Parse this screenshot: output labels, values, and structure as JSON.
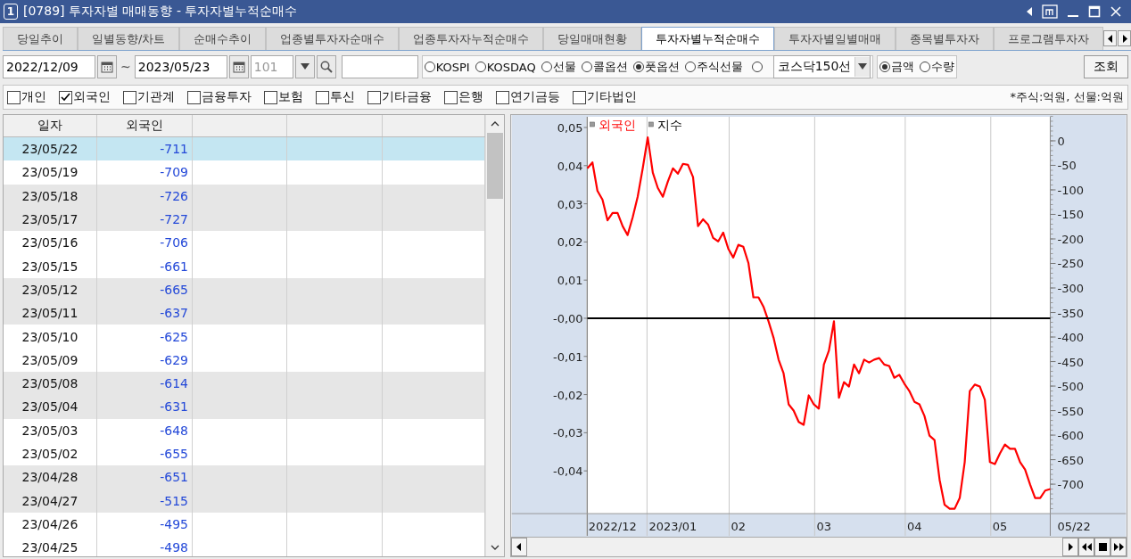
{
  "window": {
    "badge": "1",
    "title": "[0789] 투자자별 매매동향 - 투자자별누적순매수"
  },
  "tabs": [
    {
      "label": "당일추이",
      "selected": false
    },
    {
      "label": "일별동향/차트",
      "selected": false
    },
    {
      "label": "순매수추이",
      "selected": false
    },
    {
      "label": "업종별투자자순매수",
      "selected": false
    },
    {
      "label": "업종투자자누적순매수",
      "selected": false
    },
    {
      "label": "당일매매현황",
      "selected": false
    },
    {
      "label": "투자자별누적순매수",
      "selected": true
    },
    {
      "label": "투자자별일별매매",
      "selected": false
    },
    {
      "label": "종목별투자자",
      "selected": false
    },
    {
      "label": "프로그램투자자",
      "selected": false
    }
  ],
  "query": {
    "start_date": "2022/12/09",
    "separator": "~",
    "end_date": "2023/05/23",
    "code": {
      "value": "101",
      "disabled": true
    },
    "market_options": [
      {
        "label": "KOSPI",
        "selected": false
      },
      {
        "label": "KOSDAQ",
        "selected": false
      },
      {
        "label": "선물",
        "selected": false
      },
      {
        "label": "콜옵션",
        "selected": false
      },
      {
        "label": "풋옵션",
        "selected": true
      },
      {
        "label": "주식선물",
        "selected": false
      }
    ],
    "index_option": {
      "selected": false,
      "combo": "코스닥150선"
    },
    "unit_options": [
      {
        "label": "금액",
        "selected": true
      },
      {
        "label": "수량",
        "selected": false
      }
    ],
    "submit": "조회"
  },
  "investors": [
    {
      "label": "개인",
      "checked": false
    },
    {
      "label": "외국인",
      "checked": true
    },
    {
      "label": "기관계",
      "checked": false
    },
    {
      "label": "금융투자",
      "checked": false
    },
    {
      "label": "보험",
      "checked": false
    },
    {
      "label": "투신",
      "checked": false
    },
    {
      "label": "기타금융",
      "checked": false
    },
    {
      "label": "은행",
      "checked": false
    },
    {
      "label": "연기금등",
      "checked": false
    },
    {
      "label": "기타법인",
      "checked": false
    }
  ],
  "unit_note": "*주식:억원, 선물:억원",
  "table": {
    "columns": [
      "일자",
      "외국인"
    ],
    "rows": [
      {
        "date": "23/05/22",
        "value": "-711",
        "selected": true
      },
      {
        "date": "23/05/19",
        "value": "-709",
        "selected": false
      },
      {
        "date": "23/05/18",
        "value": "-726",
        "selected": false
      },
      {
        "date": "23/05/17",
        "value": "-727",
        "selected": false
      },
      {
        "date": "23/05/16",
        "value": "-706",
        "selected": false
      },
      {
        "date": "23/05/15",
        "value": "-661",
        "selected": false
      },
      {
        "date": "23/05/12",
        "value": "-665",
        "selected": false
      },
      {
        "date": "23/05/11",
        "value": "-637",
        "selected": false
      },
      {
        "date": "23/05/10",
        "value": "-625",
        "selected": false
      },
      {
        "date": "23/05/09",
        "value": "-629",
        "selected": false
      },
      {
        "date": "23/05/08",
        "value": "-614",
        "selected": false
      },
      {
        "date": "23/05/04",
        "value": "-631",
        "selected": false
      },
      {
        "date": "23/05/03",
        "value": "-648",
        "selected": false
      },
      {
        "date": "23/05/02",
        "value": "-655",
        "selected": false
      },
      {
        "date": "23/04/28",
        "value": "-651",
        "selected": false
      },
      {
        "date": "23/04/27",
        "value": "-515",
        "selected": false
      },
      {
        "date": "23/04/26",
        "value": "-495",
        "selected": false
      },
      {
        "date": "23/04/25",
        "value": "-498",
        "selected": false
      }
    ]
  },
  "chart": {
    "chart_data": {
      "type": "line",
      "categories": [
        null,
        null,
        null,
        null,
        null,
        "2022/12",
        null,
        null,
        null,
        null,
        null,
        null,
        null,
        null,
        null,
        null,
        null,
        "2023/01",
        null,
        null,
        null,
        null,
        null,
        null,
        null,
        null,
        null,
        null,
        null,
        null,
        "02",
        null,
        null,
        null,
        null,
        null,
        null,
        null,
        null,
        null,
        null,
        null,
        null,
        null,
        null,
        null,
        null,
        "03",
        null,
        null,
        null,
        null,
        null,
        null,
        null,
        null,
        null,
        null,
        null,
        null,
        null,
        null,
        null,
        null,
        null,
        "04",
        null,
        null,
        null,
        null,
        null,
        null,
        null,
        null,
        null,
        null,
        null,
        null,
        null,
        null,
        null,
        null,
        "05",
        null,
        null,
        null,
        null,
        null,
        null,
        null,
        null,
        null,
        null
      ],
      "series": [
        {
          "name": "외국인",
          "color": "#ff0000",
          "axis": "y2",
          "values": [
            -56,
            -44,
            -102,
            -120,
            -162,
            -147,
            -147,
            -174,
            -192,
            -156,
            -114,
            -56,
            7,
            -65,
            -96,
            -114,
            -83,
            -56,
            -67,
            -47,
            -49,
            -74,
            -174,
            -160,
            -171,
            -198,
            -205,
            -187,
            -220,
            -238,
            -212,
            -216,
            -249,
            -319,
            -319,
            -338,
            -368,
            -401,
            -446,
            -474,
            -537,
            -550,
            -573,
            -579,
            -519,
            -537,
            -546,
            -456,
            -428,
            -368,
            -524,
            -492,
            -501,
            -456,
            -474,
            -446,
            -452,
            -446,
            -443,
            -456,
            -459,
            -483,
            -477,
            -495,
            -510,
            -532,
            -537,
            -561,
            -601,
            -610,
            -691,
            -742,
            -750,
            -750,
            -728,
            -655,
            -510,
            -497,
            -501,
            -528,
            -655,
            -659,
            -637,
            -619,
            -628,
            -628,
            -655,
            -670,
            -701,
            -728,
            -728,
            -713,
            -710
          ]
        },
        {
          "name": "지수",
          "color": "#000000",
          "values": [
            0,
            0,
            0,
            0,
            0,
            0,
            0,
            0,
            0,
            0,
            0,
            0,
            0,
            0,
            0,
            0,
            0,
            0,
            0,
            0,
            0,
            0,
            0,
            0,
            0,
            0,
            0,
            0,
            0,
            0,
            0,
            0,
            0,
            0,
            0,
            0,
            0,
            0,
            0,
            0,
            0,
            0,
            0,
            0,
            0,
            0,
            0,
            0,
            0,
            0,
            0,
            0,
            0,
            0,
            0,
            0,
            0,
            0,
            0,
            0,
            0,
            0,
            0,
            0,
            0,
            0,
            0,
            0,
            0,
            0,
            0,
            0,
            0,
            0,
            0,
            0,
            0,
            0,
            0,
            0,
            0,
            0,
            0,
            0,
            0,
            0,
            0,
            0,
            0,
            0,
            0,
            0,
            0
          ]
        }
      ],
      "y2lim": [
        -760,
        49
      ],
      "y2ticks": [
        {
          "value": 0,
          "label": "0"
        },
        {
          "value": -50,
          "label": "-50"
        },
        {
          "value": -100,
          "label": "-100"
        },
        {
          "value": -150,
          "label": "-150"
        },
        {
          "value": -200,
          "label": "-200"
        },
        {
          "value": -250,
          "label": "-250"
        },
        {
          "value": -300,
          "label": "-300"
        },
        {
          "value": -350,
          "label": "-350"
        },
        {
          "value": -400,
          "label": "-400"
        },
        {
          "value": -450,
          "label": "-450"
        },
        {
          "value": -500,
          "label": "-500"
        },
        {
          "value": -550,
          "label": "-550"
        },
        {
          "value": -600,
          "label": "-600"
        },
        {
          "value": -650,
          "label": "-650"
        },
        {
          "value": -700,
          "label": "-700"
        }
      ],
      "ylim": [
        -0.0512,
        0.0528
      ],
      "yticks": [
        {
          "value": 0.05,
          "label": "0,05"
        },
        {
          "value": 0.04,
          "label": "0,04"
        },
        {
          "value": 0.03,
          "label": "0,03"
        },
        {
          "value": 0.02,
          "label": "0,02"
        },
        {
          "value": 0.01,
          "label": "0,01"
        },
        {
          "value": 0,
          "label": "-0,00"
        },
        {
          "value": -0.01,
          "label": "-0,01"
        },
        {
          "value": -0.02,
          "label": "-0,02"
        },
        {
          "value": -0.03,
          "label": "-0,03"
        },
        {
          "value": -0.04,
          "label": "-0,04"
        }
      ]
    },
    "end_date_label": "05/22"
  }
}
